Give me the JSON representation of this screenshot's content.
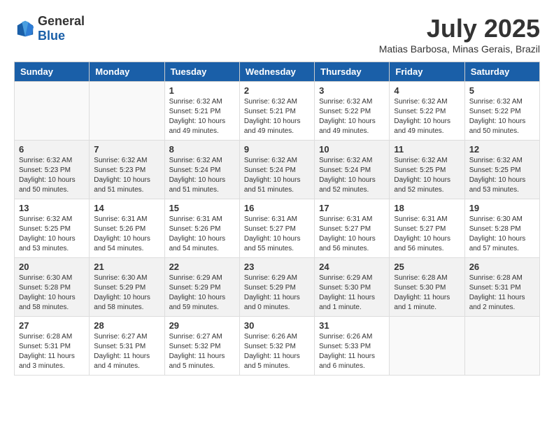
{
  "logo": {
    "general": "General",
    "blue": "Blue"
  },
  "title": "July 2025",
  "subtitle": "Matias Barbosa, Minas Gerais, Brazil",
  "headers": [
    "Sunday",
    "Monday",
    "Tuesday",
    "Wednesday",
    "Thursday",
    "Friday",
    "Saturday"
  ],
  "weeks": [
    [
      {
        "day": "",
        "info": ""
      },
      {
        "day": "",
        "info": ""
      },
      {
        "day": "1",
        "info": "Sunrise: 6:32 AM\nSunset: 5:21 PM\nDaylight: 10 hours and 49 minutes."
      },
      {
        "day": "2",
        "info": "Sunrise: 6:32 AM\nSunset: 5:21 PM\nDaylight: 10 hours and 49 minutes."
      },
      {
        "day": "3",
        "info": "Sunrise: 6:32 AM\nSunset: 5:22 PM\nDaylight: 10 hours and 49 minutes."
      },
      {
        "day": "4",
        "info": "Sunrise: 6:32 AM\nSunset: 5:22 PM\nDaylight: 10 hours and 49 minutes."
      },
      {
        "day": "5",
        "info": "Sunrise: 6:32 AM\nSunset: 5:22 PM\nDaylight: 10 hours and 50 minutes."
      }
    ],
    [
      {
        "day": "6",
        "info": "Sunrise: 6:32 AM\nSunset: 5:23 PM\nDaylight: 10 hours and 50 minutes."
      },
      {
        "day": "7",
        "info": "Sunrise: 6:32 AM\nSunset: 5:23 PM\nDaylight: 10 hours and 51 minutes."
      },
      {
        "day": "8",
        "info": "Sunrise: 6:32 AM\nSunset: 5:24 PM\nDaylight: 10 hours and 51 minutes."
      },
      {
        "day": "9",
        "info": "Sunrise: 6:32 AM\nSunset: 5:24 PM\nDaylight: 10 hours and 51 minutes."
      },
      {
        "day": "10",
        "info": "Sunrise: 6:32 AM\nSunset: 5:24 PM\nDaylight: 10 hours and 52 minutes."
      },
      {
        "day": "11",
        "info": "Sunrise: 6:32 AM\nSunset: 5:25 PM\nDaylight: 10 hours and 52 minutes."
      },
      {
        "day": "12",
        "info": "Sunrise: 6:32 AM\nSunset: 5:25 PM\nDaylight: 10 hours and 53 minutes."
      }
    ],
    [
      {
        "day": "13",
        "info": "Sunrise: 6:32 AM\nSunset: 5:25 PM\nDaylight: 10 hours and 53 minutes."
      },
      {
        "day": "14",
        "info": "Sunrise: 6:31 AM\nSunset: 5:26 PM\nDaylight: 10 hours and 54 minutes."
      },
      {
        "day": "15",
        "info": "Sunrise: 6:31 AM\nSunset: 5:26 PM\nDaylight: 10 hours and 54 minutes."
      },
      {
        "day": "16",
        "info": "Sunrise: 6:31 AM\nSunset: 5:27 PM\nDaylight: 10 hours and 55 minutes."
      },
      {
        "day": "17",
        "info": "Sunrise: 6:31 AM\nSunset: 5:27 PM\nDaylight: 10 hours and 56 minutes."
      },
      {
        "day": "18",
        "info": "Sunrise: 6:31 AM\nSunset: 5:27 PM\nDaylight: 10 hours and 56 minutes."
      },
      {
        "day": "19",
        "info": "Sunrise: 6:30 AM\nSunset: 5:28 PM\nDaylight: 10 hours and 57 minutes."
      }
    ],
    [
      {
        "day": "20",
        "info": "Sunrise: 6:30 AM\nSunset: 5:28 PM\nDaylight: 10 hours and 58 minutes."
      },
      {
        "day": "21",
        "info": "Sunrise: 6:30 AM\nSunset: 5:29 PM\nDaylight: 10 hours and 58 minutes."
      },
      {
        "day": "22",
        "info": "Sunrise: 6:29 AM\nSunset: 5:29 PM\nDaylight: 10 hours and 59 minutes."
      },
      {
        "day": "23",
        "info": "Sunrise: 6:29 AM\nSunset: 5:29 PM\nDaylight: 11 hours and 0 minutes."
      },
      {
        "day": "24",
        "info": "Sunrise: 6:29 AM\nSunset: 5:30 PM\nDaylight: 11 hours and 1 minute."
      },
      {
        "day": "25",
        "info": "Sunrise: 6:28 AM\nSunset: 5:30 PM\nDaylight: 11 hours and 1 minute."
      },
      {
        "day": "26",
        "info": "Sunrise: 6:28 AM\nSunset: 5:31 PM\nDaylight: 11 hours and 2 minutes."
      }
    ],
    [
      {
        "day": "27",
        "info": "Sunrise: 6:28 AM\nSunset: 5:31 PM\nDaylight: 11 hours and 3 minutes."
      },
      {
        "day": "28",
        "info": "Sunrise: 6:27 AM\nSunset: 5:31 PM\nDaylight: 11 hours and 4 minutes."
      },
      {
        "day": "29",
        "info": "Sunrise: 6:27 AM\nSunset: 5:32 PM\nDaylight: 11 hours and 5 minutes."
      },
      {
        "day": "30",
        "info": "Sunrise: 6:26 AM\nSunset: 5:32 PM\nDaylight: 11 hours and 5 minutes."
      },
      {
        "day": "31",
        "info": "Sunrise: 6:26 AM\nSunset: 5:33 PM\nDaylight: 11 hours and 6 minutes."
      },
      {
        "day": "",
        "info": ""
      },
      {
        "day": "",
        "info": ""
      }
    ]
  ]
}
